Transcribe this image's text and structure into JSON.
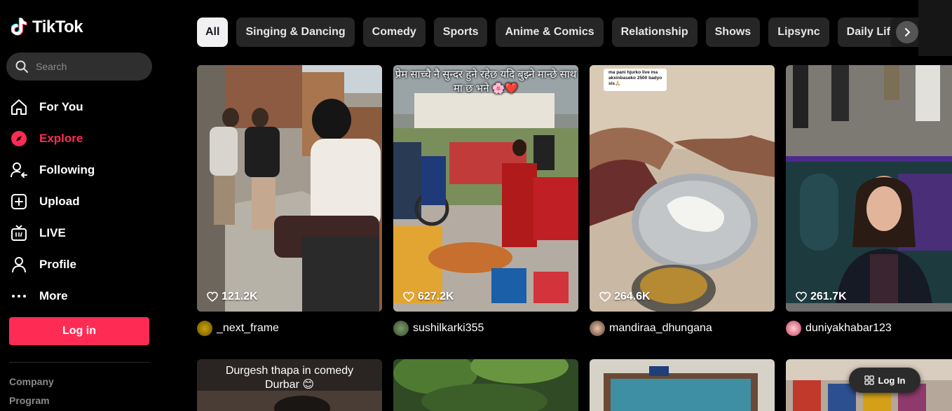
{
  "app": {
    "name": "TikTok"
  },
  "search": {
    "placeholder": "Search"
  },
  "nav": [
    {
      "label": "For You",
      "icon": "home-icon"
    },
    {
      "label": "Explore",
      "icon": "compass-icon",
      "active": true
    },
    {
      "label": "Following",
      "icon": "following-icon"
    },
    {
      "label": "Upload",
      "icon": "upload-icon"
    },
    {
      "label": "LIVE",
      "icon": "live-icon"
    },
    {
      "label": "Profile",
      "icon": "profile-icon"
    },
    {
      "label": "More",
      "icon": "more-icon"
    }
  ],
  "login": {
    "label": "Log in"
  },
  "footer": {
    "company": "Company",
    "program": "Program"
  },
  "categories": [
    "All",
    "Singing & Dancing",
    "Comedy",
    "Sports",
    "Anime & Comics",
    "Relationship",
    "Shows",
    "Lipsync",
    "Daily Life"
  ],
  "videos": [
    {
      "likes": "121.2K",
      "author": "_next_frame"
    },
    {
      "likes": "627.2K",
      "author": "sushilkarki355",
      "caption": "प्रेम साच्चै नै सुन्दर हुने रहेछ यदि बुझ्ने मान्छे साथ मा छ भने 🌸❤️"
    },
    {
      "likes": "264.6K",
      "author": "mandiraa_dhungana",
      "caption": "ma pani hjurko live ma akxinbaseko 2500 badyo sis🙏"
    },
    {
      "likes": "261.7K",
      "author": "duniyakhabar123"
    }
  ],
  "videos_row2": [
    {
      "caption_line1": "Durgesh thapa in comedy",
      "caption_line2": "Durbar 😊"
    }
  ],
  "float_login": {
    "label": "Log In"
  },
  "colors": {
    "accent": "#fe2c55",
    "chip_bg": "#262626",
    "chip_active_bg": "#f1f1f2"
  }
}
